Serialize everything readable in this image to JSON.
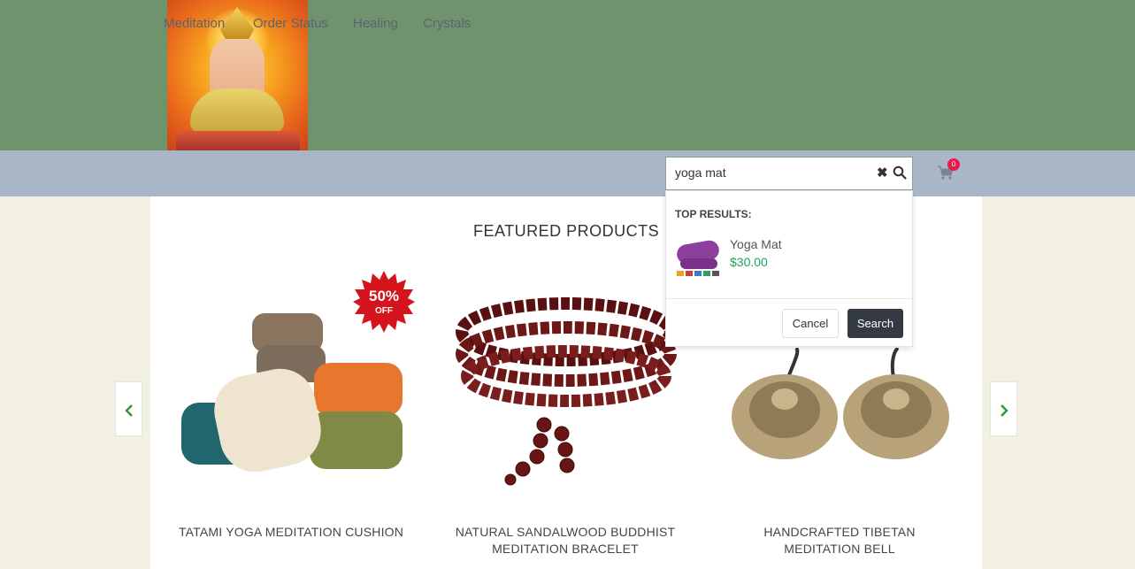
{
  "nav": {
    "items": [
      {
        "label": "Meditation"
      },
      {
        "label": "Order Status"
      },
      {
        "label": "Healing"
      },
      {
        "label": "Crystals"
      }
    ]
  },
  "search": {
    "value": "yoga mat",
    "clear_icon": "close-icon",
    "submit_icon": "search-icon"
  },
  "cart": {
    "icon": "cart-icon",
    "count": "0"
  },
  "search_dropdown": {
    "heading": "TOP RESULTS:",
    "results": [
      {
        "name": "Yoga Mat",
        "price": "$30.00"
      }
    ],
    "cancel_label": "Cancel",
    "search_label": "Search"
  },
  "featured": {
    "title": "FEATURED PRODUCTS",
    "products": [
      {
        "name": "TATAMI YOGA MEDITATION CUSHION",
        "badge": "50% OFF"
      },
      {
        "name": "NATURAL SANDALWOOD BUDDHIST MEDITATION BRACELET"
      },
      {
        "name": "HANDCRAFTED TIBETAN MEDITATION BELL"
      }
    ],
    "prev_icon": "chevron-left-icon",
    "next_icon": "chevron-right-icon"
  },
  "colors": {
    "header_bg": "#6e936d",
    "nav_bg": "#a9b6c7",
    "page_bg": "#f2f0e3",
    "price_green": "#17a55b",
    "badge_red": "#e8194b",
    "button_dark": "#333a44"
  }
}
